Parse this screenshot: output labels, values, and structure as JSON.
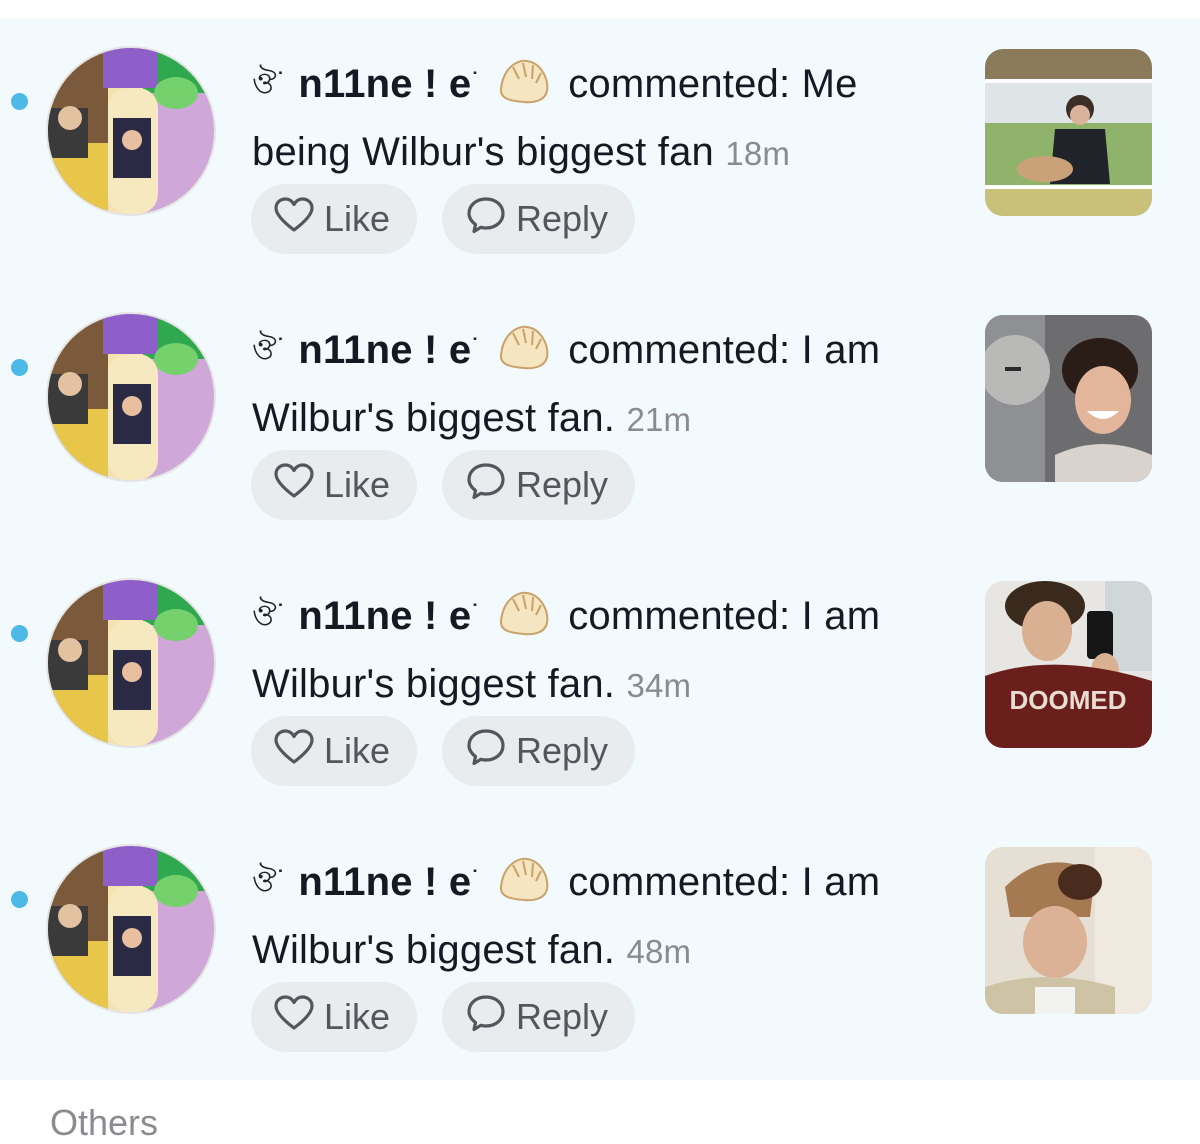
{
  "colors": {
    "unread_dot": "#4cb9e7",
    "feed_background": "#f3fafd",
    "button_background": "#e8ecee",
    "timestamp": "#8a8b91"
  },
  "notifications": [
    {
      "username": "n11ne ! e",
      "action": "commented:",
      "comment": "Me being Wilbur's biggest fan",
      "time": "18m",
      "like_label": "Like",
      "reply_label": "Reply",
      "unread": true,
      "thumbnail_icon": "video-thumbnail-guitar"
    },
    {
      "username": "n11ne ! e",
      "action": "commented:",
      "comment": "I am Wilbur's biggest fan.",
      "time": "21m",
      "like_label": "Like",
      "reply_label": "Reply",
      "unread": true,
      "thumbnail_icon": "video-thumbnail-smiling"
    },
    {
      "username": "n11ne ! e",
      "action": "commented:",
      "comment": "I am Wilbur's biggest fan.",
      "time": "34m",
      "like_label": "Like",
      "reply_label": "Reply",
      "unread": true,
      "thumbnail_icon": "video-thumbnail-mirror-selfie"
    },
    {
      "username": "n11ne ! e",
      "action": "commented:",
      "comment": "I am Wilbur's biggest fan.",
      "time": "48m",
      "like_label": "Like",
      "reply_label": "Reply",
      "unread": true,
      "thumbnail_icon": "video-thumbnail-beanie"
    }
  ],
  "others_section": {
    "title": "Others"
  }
}
